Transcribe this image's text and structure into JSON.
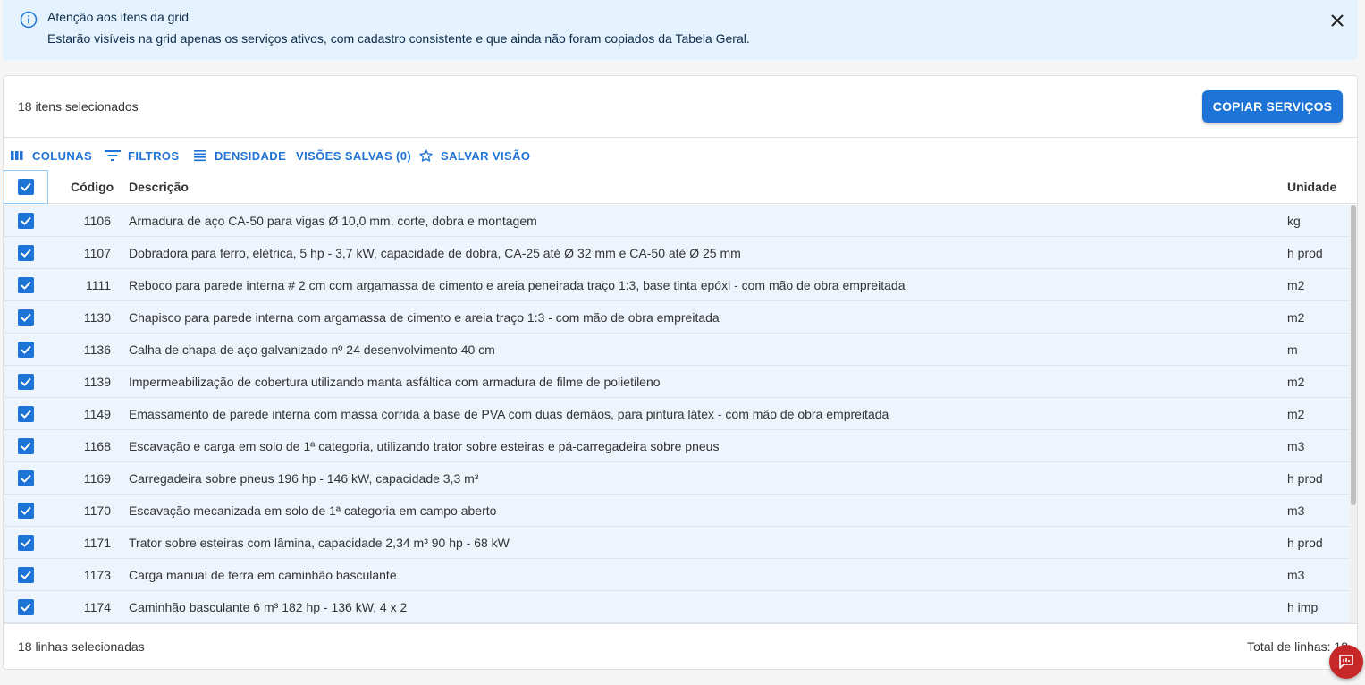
{
  "alert": {
    "title": "Atenção aos itens da grid",
    "message": "Estarão visíveis na grid apenas os serviços ativos, com cadastro consistente e que ainda não foram copiados da Tabela Geral.",
    "icon": "info-icon",
    "close_icon": "close-icon"
  },
  "header": {
    "selected_text": "18 itens selecionados",
    "copy_button": "COPIAR SERVIÇOS"
  },
  "toolbar": {
    "columns": "COLUNAS",
    "filters": "FILTROS",
    "density": "DENSIDADE",
    "saved_views": "VISÕES SALVAS (0)",
    "save_view": "SALVAR VISÃO"
  },
  "grid": {
    "columns": {
      "code": "Código",
      "description": "Descrição",
      "unit": "Unidade"
    },
    "rows": [
      {
        "code": "1106",
        "description": "Armadura de aço CA-50 para vigas Ø 10,0 mm, corte, dobra e montagem",
        "unit": "kg",
        "checked": true
      },
      {
        "code": "1107",
        "description": "Dobradora para ferro, elétrica, 5 hp - 3,7 kW, capacidade de dobra, CA-25 até Ø 32 mm e CA-50 até Ø 25 mm",
        "unit": "h prod",
        "checked": true
      },
      {
        "code": "1111",
        "description": "Reboco para parede interna # 2 cm com argamassa de cimento e areia peneirada traço 1:3, base tinta epóxi - com mão de obra empreitada",
        "unit": "m2",
        "checked": true
      },
      {
        "code": "1130",
        "description": "Chapisco para parede interna com argamassa de cimento e areia traço 1:3 - com mão de obra empreitada",
        "unit": "m2",
        "checked": true
      },
      {
        "code": "1136",
        "description": "Calha de chapa de aço galvanizado nº 24 desenvolvimento 40 cm",
        "unit": "m",
        "checked": true
      },
      {
        "code": "1139",
        "description": "Impermeabilização de cobertura utilizando manta asfáltica com armadura de filme de polietileno",
        "unit": "m2",
        "checked": true
      },
      {
        "code": "1149",
        "description": "Emassamento de parede interna com massa corrida à base de PVA com duas demãos, para pintura látex - com mão de obra empreitada",
        "unit": "m2",
        "checked": true
      },
      {
        "code": "1168",
        "description": "Escavação e carga em solo de 1ª categoria, utilizando trator sobre esteiras e pá-carregadeira sobre pneus",
        "unit": "m3",
        "checked": true
      },
      {
        "code": "1169",
        "description": "Carregadeira sobre pneus 196 hp - 146 kW, capacidade 3,3 m³",
        "unit": "h prod",
        "checked": true
      },
      {
        "code": "1170",
        "description": "Escavação mecanizada em solo de 1ª categoria em campo aberto",
        "unit": "m3",
        "checked": true
      },
      {
        "code": "1171",
        "description": "Trator sobre esteiras com lâmina, capacidade 2,34 m³ 90 hp - 68 kW",
        "unit": "h prod",
        "checked": true
      },
      {
        "code": "1173",
        "description": "Carga manual de terra em caminhão basculante",
        "unit": "m3",
        "checked": true
      },
      {
        "code": "1174",
        "description": "Caminhão basculante 6 m³ 182 hp - 136 kW, 4 x 2",
        "unit": "h imp",
        "checked": true
      }
    ]
  },
  "footer": {
    "selected_rows": "18 linhas selecionadas",
    "total_rows": "Total de linhas: 18"
  },
  "colors": {
    "accent": "#1e73d6",
    "alert_bg": "#e3f2fd",
    "row_selected_bg": "#edf4fc",
    "fab": "#c62828"
  }
}
